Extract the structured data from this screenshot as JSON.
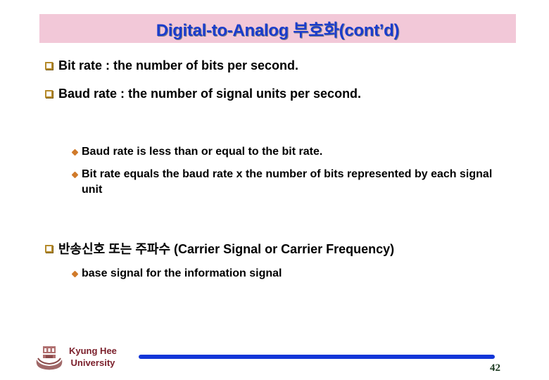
{
  "slide": {
    "title": "Digital-to-Analog 부호화(cont’d)",
    "bullets": [
      {
        "text": "Bit rate : the number of bits per second."
      },
      {
        "text": "Baud rate : the number of signal units per second."
      },
      {
        "text": "반송신호 또는 주파수 (Carrier Signal or Carrier Frequency)"
      }
    ],
    "sub_bullets_baud": [
      {
        "text": "Baud rate is less than or equal to the bit rate."
      },
      {
        "text": "Bit rate equals the baud rate x the number of bits represented by each signal unit"
      }
    ],
    "sub_bullets_carrier": [
      {
        "text": "base signal for the information signal"
      }
    ]
  },
  "footer": {
    "university_line1": "Kyung Hee",
    "university_line2": "University",
    "page_number": "42"
  },
  "colors": {
    "title_bg": "#f2c8d8",
    "title_text": "#1a3ccc",
    "rule": "#1236d8",
    "university_text": "#7a1e2a",
    "bullet_square": "#b58a2a",
    "bullet_diamond": "#d07a2a"
  }
}
